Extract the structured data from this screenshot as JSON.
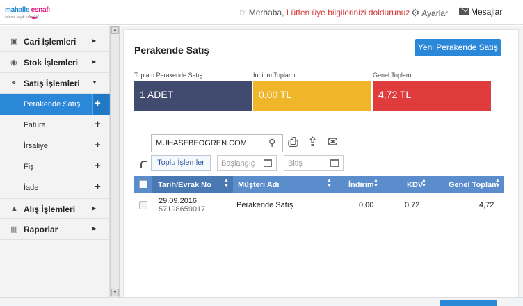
{
  "header": {
    "logo_text_a": "mahalle",
    "logo_text_b": "esnafı",
    "logo_tagline": "ödeme kaydı kolaylığı",
    "greeting": "Merhaba,",
    "greeting_warning": "Lütfen üye bilgilerinizi doldurunuz",
    "settings_label": "Ayarlar",
    "messages_label": "Mesajlar"
  },
  "sidebar": {
    "items": [
      {
        "label": "Cari İşlemleri",
        "icon": "address-card-icon"
      },
      {
        "label": "Stok İşlemleri",
        "icon": "box-icon"
      },
      {
        "label": "Satış İşlemleri",
        "icon": "handshake-icon"
      },
      {
        "label": "Alış İşlemleri",
        "icon": "basket-icon"
      },
      {
        "label": "Raporlar",
        "icon": "bar-chart-icon"
      }
    ],
    "sub_items": [
      {
        "label": "Perakende Satış"
      },
      {
        "label": "Fatura"
      },
      {
        "label": "İrsaliye"
      },
      {
        "label": "Fiş"
      },
      {
        "label": "İade"
      }
    ]
  },
  "main": {
    "title": "Perakende Satış",
    "new_button": "Yeni Perakende Satış",
    "summary": [
      {
        "label": "Toplam Perakende Satış",
        "value": "1 ADET",
        "color": "#414b70"
      },
      {
        "label": "İndirim Toplamı",
        "value": "0,00 TL",
        "color": "#f0b629"
      },
      {
        "label": "Genel Toplam",
        "value": "4,72 TL",
        "color": "#e03c3e"
      }
    ],
    "search_value": "MUHASEBEOGREN.COM",
    "bulk_button": "Toplu İşlemler",
    "date_start_placeholder": "Başlangıç",
    "date_end_placeholder": "Bitiş",
    "table": {
      "headers": [
        "Tarih/Evrak No",
        "Müşteri Adı",
        "İndirim",
        "KDV",
        "Genel Toplam"
      ],
      "rows": [
        {
          "date": "29.09.2016",
          "doc_no": "57198659017",
          "customer": "Perakende Satış",
          "discount": "0,00",
          "vat": "0,72",
          "total": "4,72"
        }
      ]
    }
  },
  "accent_color": "#2b88d8"
}
